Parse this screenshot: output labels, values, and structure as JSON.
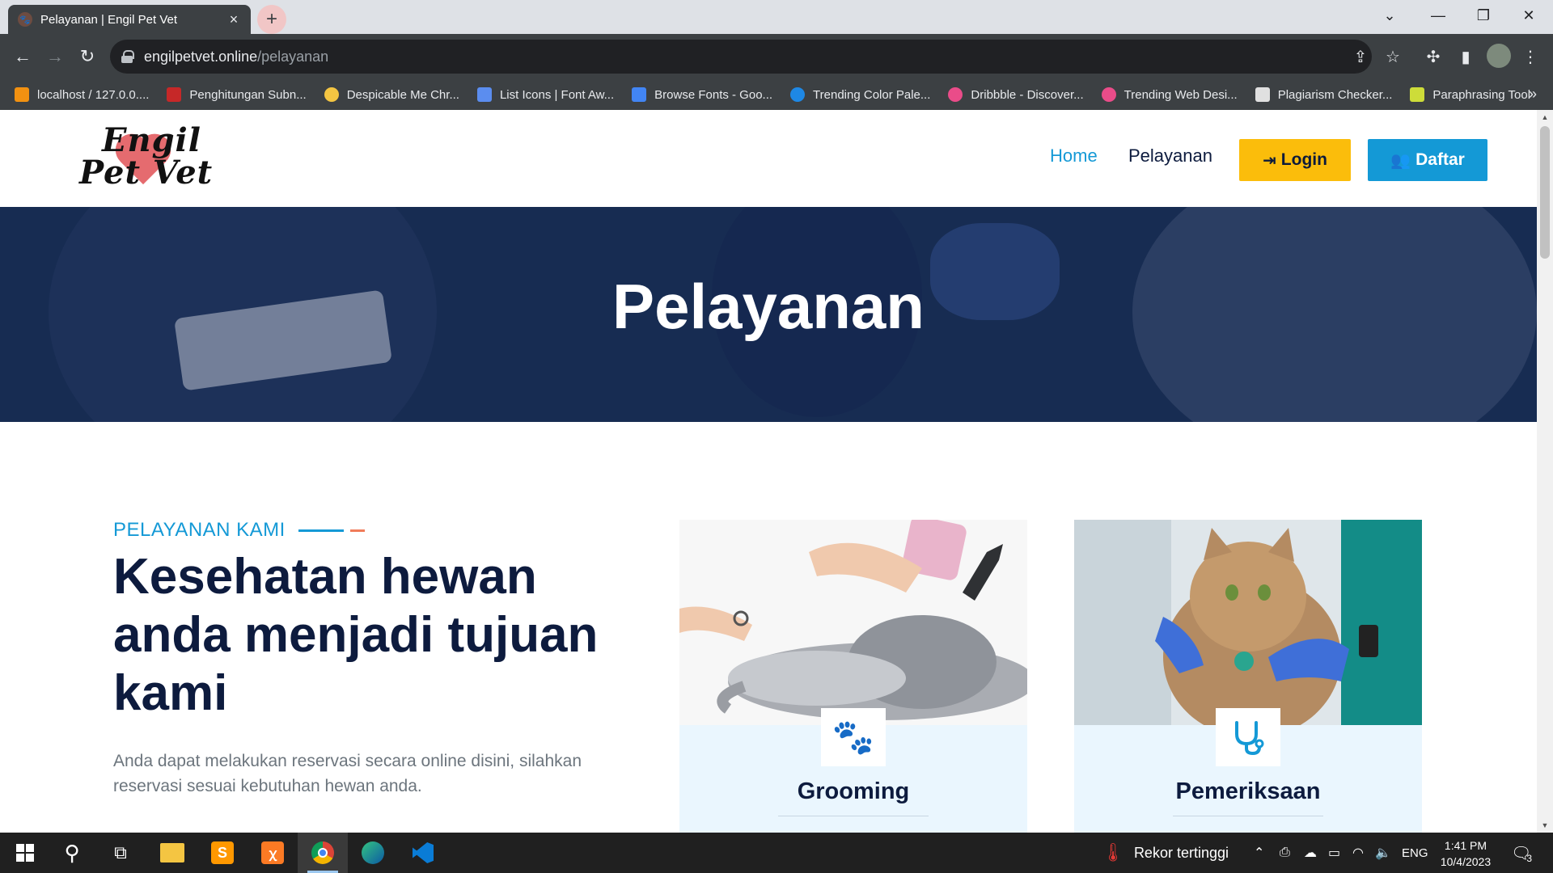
{
  "browser": {
    "tab_title": "Pelayanan | Engil Pet Vet",
    "url_host": "engilpetvet.online",
    "url_path": "/pelayanan",
    "bookmarks": [
      {
        "label": "localhost / 127.0.0....",
        "color": "#f29111"
      },
      {
        "label": "Penghitungan Subn...",
        "color": "#c62828"
      },
      {
        "label": "Despicable Me Chr...",
        "color": "#f4c542"
      },
      {
        "label": "List Icons | Font Aw...",
        "color": "#5b8def"
      },
      {
        "label": "Browse Fonts - Goo...",
        "color": "#4285f4"
      },
      {
        "label": "Trending Color Pale...",
        "color": "#1e88e5"
      },
      {
        "label": "Dribbble - Discover...",
        "color": "#ea4c89"
      },
      {
        "label": "Trending Web Desi...",
        "color": "#ea4c89"
      },
      {
        "label": "Plagiarism Checker...",
        "color": "#e0e0e0"
      },
      {
        "label": "Paraphrasing Tool",
        "color": "#cddc39"
      }
    ]
  },
  "site": {
    "logo_line1": "Engil",
    "logo_line2": "Pet Vet",
    "nav": {
      "home": "Home",
      "services": "Pelayanan"
    },
    "login_label": "Login",
    "register_label": "Daftar",
    "hero_title": "Pelayanan",
    "eyebrow": "PELAYANAN KAMI",
    "headline": "Kesehatan hewan anda menjadi tujuan kami",
    "lead": "Anda dapat melakukan reservasi secara online disini, silahkan reservasi sesuai kebutuhan hewan anda.",
    "cards": [
      {
        "title": "Grooming",
        "icon": "paw-icon"
      },
      {
        "title": "Pemeriksaan",
        "icon": "stethoscope-icon"
      }
    ]
  },
  "colors": {
    "accent": "#1499d6",
    "login_bg": "#fbbd0b",
    "register_bg": "#1499d6",
    "hero_bg": "#1e3358",
    "heading": "#0d1b3e"
  },
  "taskbar": {
    "weather": "Rekor tertinggi",
    "lang": "ENG",
    "time": "1:41 PM",
    "date": "10/4/2023",
    "notifications": "3"
  }
}
